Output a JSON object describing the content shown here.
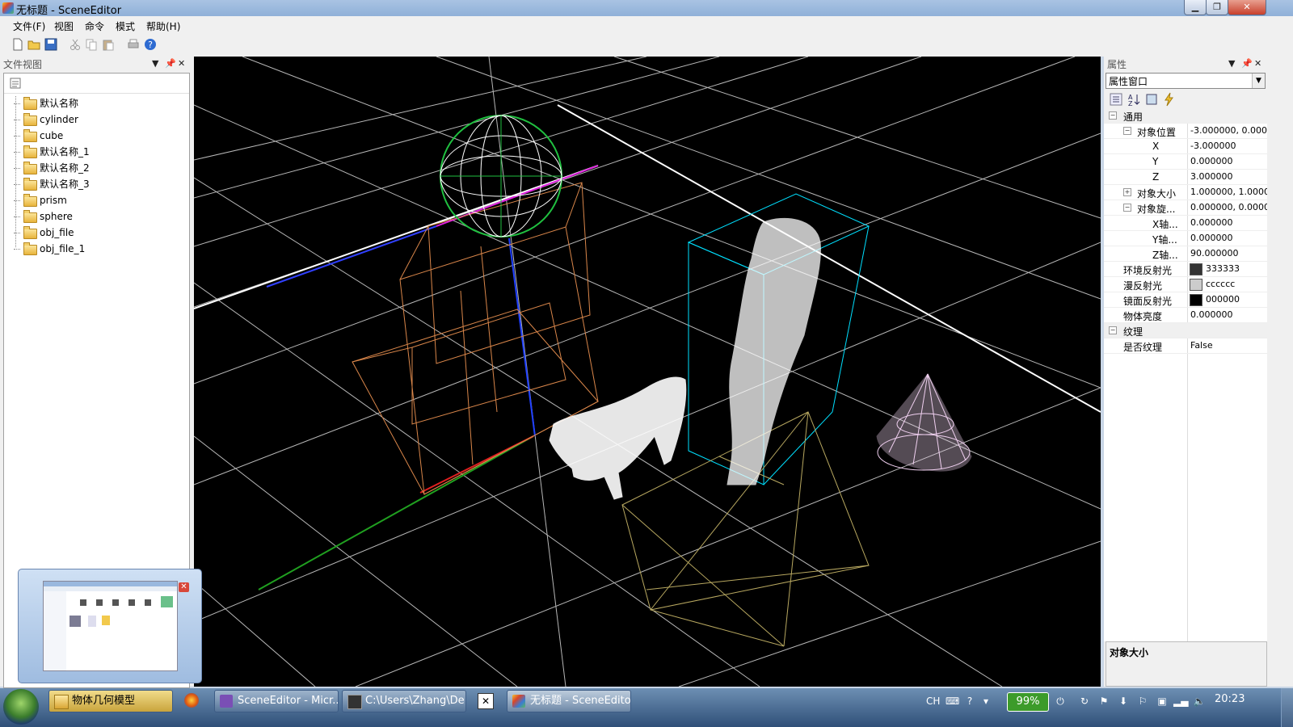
{
  "window": {
    "title": "无标题 - SceneEditor"
  },
  "menu": [
    "文件(F)",
    "视图",
    "命令",
    "模式",
    "帮助(H)"
  ],
  "toolbar_icons": [
    "new-icon",
    "open-icon",
    "save-icon",
    "cut-icon",
    "copy-icon",
    "paste-icon",
    "print-icon",
    "help-icon"
  ],
  "file_view": {
    "title": "文件视图",
    "items": [
      "默认名称",
      "cylinder",
      "cube",
      "默认名称_1",
      "默认名称_2",
      "默认名称_3",
      "prism",
      "sphere",
      "obj_file",
      "obj_file_1"
    ]
  },
  "properties": {
    "title": "属性",
    "combo_value": "属性窗口",
    "cat_general": "通用",
    "obj_pos": {
      "name": "对象位置",
      "value": "-3.000000, 0.000..."
    },
    "x": {
      "name": "X",
      "value": "-3.000000"
    },
    "y": {
      "name": "Y",
      "value": "0.000000"
    },
    "z": {
      "name": "Z",
      "value": "3.000000"
    },
    "obj_size": {
      "name": "对象大小",
      "value": "1.000000, 1.0000..."
    },
    "obj_rot": {
      "name": "对象旋...",
      "value": "0.000000, 0.0000..."
    },
    "rx": {
      "name": "X轴...",
      "value": "0.000000"
    },
    "ry": {
      "name": "Y轴...",
      "value": "0.000000"
    },
    "rz": {
      "name": "Z轴...",
      "value": "90.000000"
    },
    "ambient": {
      "name": "环境反射光",
      "value": "333333",
      "color": "#333333"
    },
    "diffuse": {
      "name": "漫反射光",
      "value": "cccccc",
      "color": "#cccccc"
    },
    "specular": {
      "name": "镜面反射光",
      "value": "000000",
      "color": "#000000"
    },
    "brightness": {
      "name": "物体亮度",
      "value": "0.000000"
    },
    "cat_texture": "纹理",
    "has_texture": {
      "name": "是否纹理",
      "value": "False"
    },
    "description_title": "对象大小"
  },
  "taskbar": {
    "tasks": [
      "物体几何模型",
      "SceneEditor - Micr...",
      "C:\\Users\\Zhang\\De...",
      "无标题 - SceneEditor"
    ],
    "battery": "99%",
    "lang": "CH",
    "clock": "20:23"
  }
}
